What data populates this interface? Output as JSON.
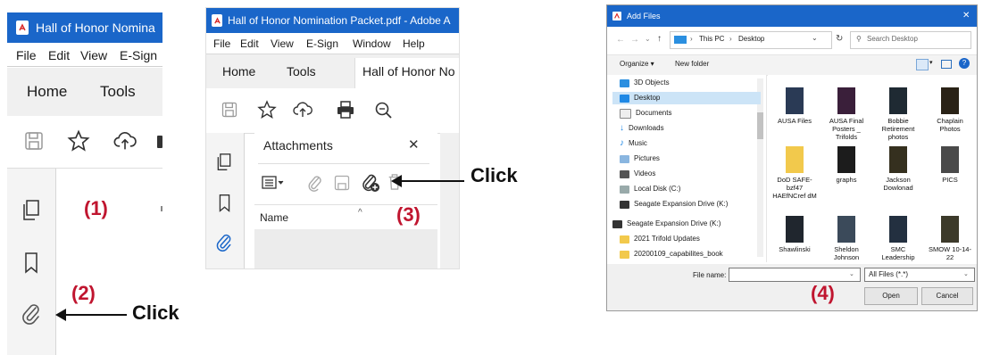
{
  "panel1": {
    "title": "Hall of Honor Nomina",
    "menu": [
      "File",
      "Edit",
      "View",
      "E-Sign"
    ],
    "tabs": [
      "Home",
      "Tools"
    ],
    "step_label": "(1)",
    "step2_label": "(2)",
    "callout": "Click"
  },
  "panel2": {
    "title": "Hall of Honor Nomination Packet.pdf - Adobe A",
    "menu": [
      "File",
      "Edit",
      "View",
      "E-Sign",
      "Window",
      "Help"
    ],
    "tabs": [
      "Home",
      "Tools",
      "Hall of Honor No"
    ],
    "attachments_title": "Attachments",
    "close_symbol": "✕",
    "column_name": "Name",
    "step_label": "(3)",
    "callout": "Click"
  },
  "panel3": {
    "title": "Add Files",
    "close_symbol": "✕",
    "breadcrumb": [
      "This PC",
      "Desktop"
    ],
    "search_placeholder": "Search Desktop",
    "organize": "Organize ▾",
    "new_folder": "New folder",
    "nav_items": [
      "3D Objects",
      "Desktop",
      "Documents",
      "Downloads",
      "Music",
      "Pictures",
      "Videos",
      "Local Disk (C:)",
      "Seagate Expansion Drive (K:)",
      "Seagate Expansion Drive (K:)",
      "2021 Trifold Updates",
      "20200109_capabilites_book"
    ],
    "files": [
      "AUSA Files",
      "AUSA Final Posters _ Trifolds",
      "Bobbie Retirement photos",
      "Chaplain Photos",
      "DoD SAFE-bzf47 HAEfNCref dM",
      "graphs",
      "Jackson Dowlonad",
      "PICS",
      "Shawlinski",
      "Sheldon Johnson",
      "SMC Leadership",
      "SMOW 10-14-22"
    ],
    "file_name_label": "File name:",
    "file_type": "All Files (*.*)",
    "open_button": "Open",
    "cancel_button": "Cancel",
    "step_label": "(4)"
  },
  "colors": {
    "accent_blue": "#1a66c9",
    "step_red": "#c0152f",
    "folder_yellow": "#f2c94c"
  }
}
